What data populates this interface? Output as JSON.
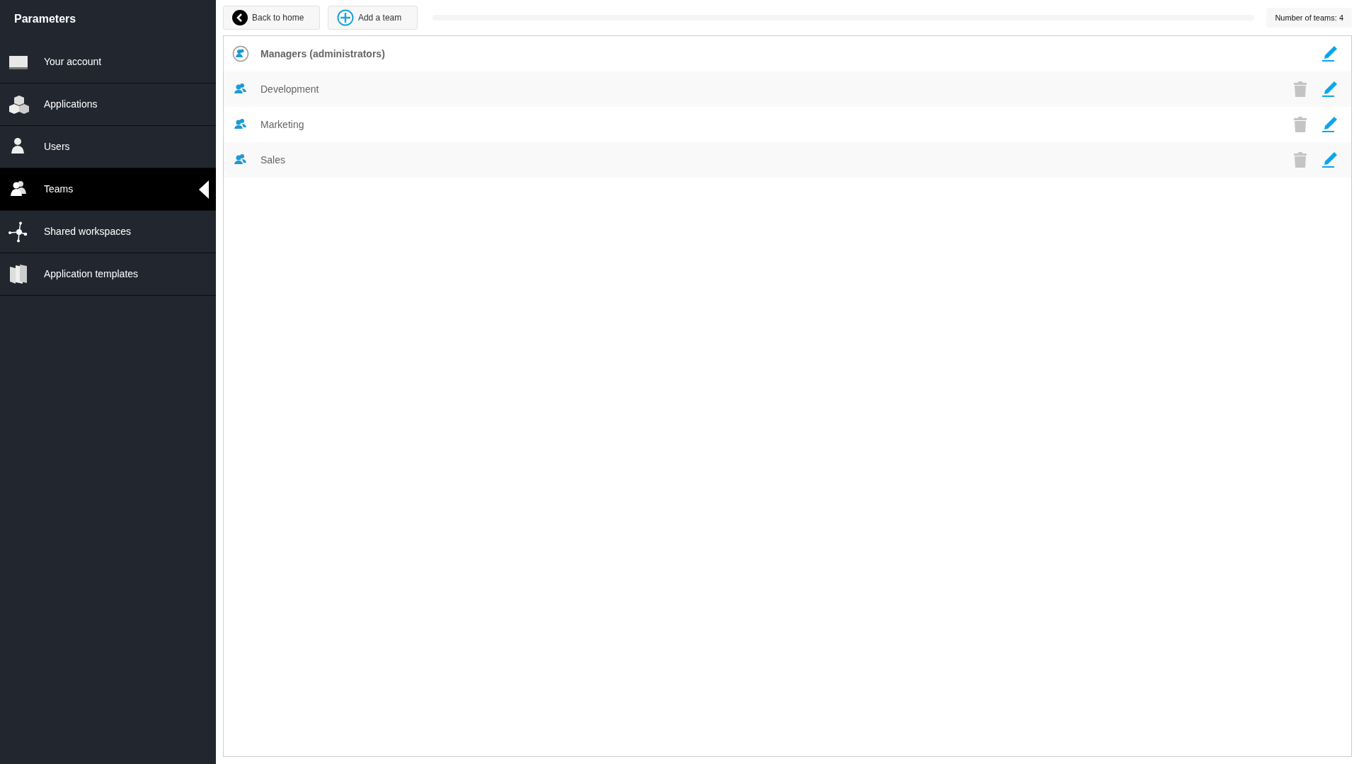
{
  "sidebar": {
    "title": "Parameters",
    "items": [
      {
        "label": "Your account",
        "kind": "account",
        "selected": false
      },
      {
        "label": "Applications",
        "kind": "applications",
        "selected": false
      },
      {
        "label": "Users",
        "kind": "users",
        "selected": false
      },
      {
        "label": "Teams",
        "kind": "teams",
        "selected": true
      },
      {
        "label": "Shared workspaces",
        "kind": "workspaces",
        "selected": false
      },
      {
        "label": "Application templates",
        "kind": "templates",
        "selected": false
      }
    ]
  },
  "toolbar": {
    "buttons": [
      {
        "label": "Back to home",
        "kind": "back"
      },
      {
        "label": "Add a team",
        "kind": "add"
      }
    ],
    "count": "Number of teams: 4"
  },
  "teams": [
    {
      "name": "Managers (administrators)",
      "kind": "admin",
      "deletable": false
    },
    {
      "name": "Development",
      "kind": "team",
      "deletable": true
    },
    {
      "name": "Marketing",
      "kind": "team",
      "deletable": true
    },
    {
      "name": "Sales",
      "kind": "team",
      "deletable": true
    }
  ]
}
